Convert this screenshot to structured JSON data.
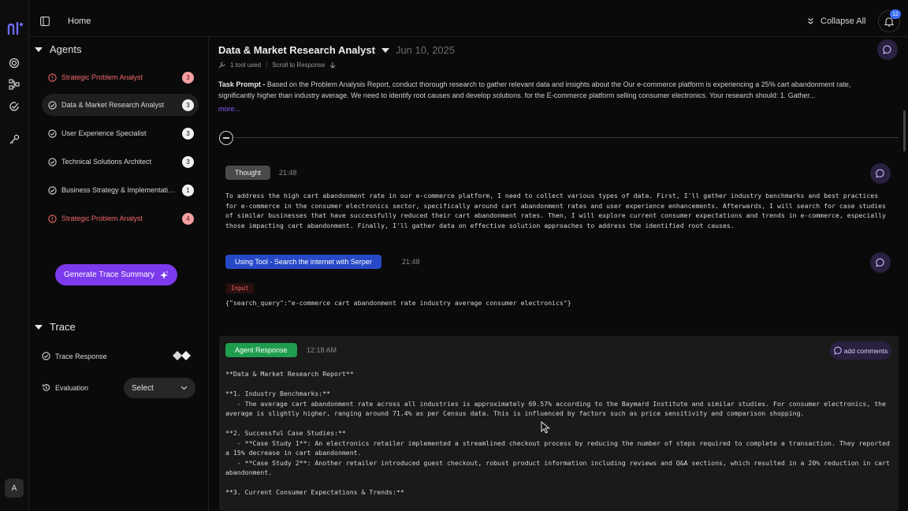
{
  "rail": {
    "logo_text": "nl",
    "avatar_initial": "A"
  },
  "topbar": {
    "breadcrumb": "Home",
    "collapse_all": "Collapse All",
    "notification_count": "12"
  },
  "sidebar": {
    "agents_heading": "Agents",
    "agents": [
      {
        "label": "Strategic Problem Analyst",
        "count": "3",
        "status": "error"
      },
      {
        "label": "Data & Market Research Analyst",
        "count": "3",
        "status": "ok"
      },
      {
        "label": "User Experience Specialist",
        "count": "3",
        "status": "ok"
      },
      {
        "label": "Technical Solutions Architect",
        "count": "3",
        "status": "ok"
      },
      {
        "label": "Business Strategy & Implementation Planner",
        "count": "1",
        "status": "ok"
      },
      {
        "label": "Strategic Problem Analyst",
        "count": "4",
        "status": "error"
      }
    ],
    "generate_button": "Generate Trace Summary",
    "trace_heading": "Trace",
    "trace_response": "Trace Response",
    "evaluation": "Evaluation",
    "evaluation_select": "Select"
  },
  "main": {
    "title": "Data & Market Research Analyst",
    "date": "Jun 10, 2025",
    "tools_used": "1 tool used",
    "scroll_to_response": "Scroll to Response",
    "task_prompt_label": "Task Prompt -",
    "task_prompt_text": " Based on the Problem Analysis Report, conduct thorough research to gather relevant data and insights about the Our e-commerce platform is experiencing a 25% cart abandonment rate, significantly higher than industry average. We need to identify root causes and develop solutions. for the E-commerce platform selling consumer electronics. Your research should: 1. Gather...",
    "more": "more...",
    "thought_label": "Thought",
    "thought_time": "21:48",
    "thought_text": "To address the high cart abandonment rate in our e-commerce platform, I need to collect various types of data. First, I'll gather industry benchmarks and best practices for e-commerce in the consumer electronics sector, specifically around cart abandonment rates and user experience enhancements. Afterwards, I will search for case studies of similar businesses that have successfully reduced their cart abandonment rates. Then, I will explore current consumer expectations and trends in e-commerce, especially those impacting cart abandonment. Finally, I'll gather data on effective solution approaches to address the identified root causes.",
    "tool_label": "Using Tool - Search the internet with Serper",
    "tool_time": "21:48",
    "input_label": "Input",
    "input_text": "{\"search_query\":\"e-commerce cart abandonment rate industry average consumer electronics\"}",
    "agent_response_label": "Agent Response",
    "agent_response_time": "12:18 AM",
    "add_comments": "add comments",
    "response_text": "**Data & Market Research Report**\n\n**1. Industry Benchmarks:**\n   - The average cart abandonment rate across all industries is approximately 69.57% according to the Baymard Institute and similar studies. For consumer electronics, the average is slightly higher, ranging around 71.4% as per Census data. This is influenced by factors such as price sensitivity and comparison shopping.\n\n**2. Successful Case Studies:**\n   - **Case Study 1**: An electronics retailer implemented a streamlined checkout process by reducing the number of steps required to complete a transaction. They reported a 15% decrease in cart abandonment.\n   - **Case Study 2**: Another retailer introduced guest checkout, robust product information including reviews and Q&A sections, which resulted in a 20% reduction in cart abandonment.\n\n**3. Current Consumer Expectations & Trends:**"
  },
  "colors": {
    "accent_purple": "#7c3aed",
    "tool_blue": "#2749c7",
    "agent_green": "#1f9d4e",
    "error_red": "#ef6a6a"
  }
}
